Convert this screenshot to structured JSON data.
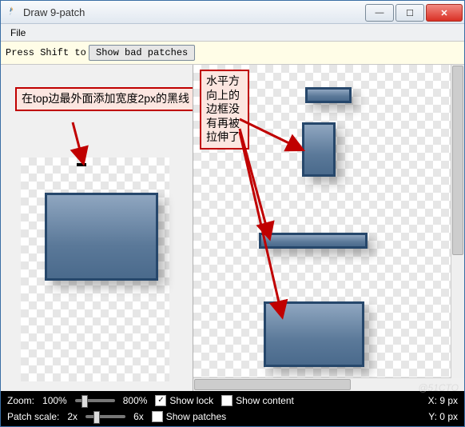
{
  "window": {
    "title": "Draw 9-patch"
  },
  "menu": {
    "file": "File"
  },
  "toolbar": {
    "hint_text": "Press Shift to er",
    "show_bad_patches_label": "Show bad patches"
  },
  "annotations": {
    "left_note": "在top边最外面添加宽度2px的黑线",
    "right_note": "水平方向上的边框没有再被拉伸了"
  },
  "statusbar": {
    "zoom_label": "Zoom:",
    "zoom_min": "100%",
    "zoom_max": "800%",
    "show_lock_label": "Show lock",
    "show_lock_checked": true,
    "show_content_label": "Show content",
    "show_content_checked": false,
    "x_label": "X: 9 px",
    "patch_scale_label": "Patch scale:",
    "patch_scale_min": "2x",
    "patch_scale_max": "6x",
    "show_patches_label": "Show patches",
    "show_patches_checked": false,
    "y_label": "Y: 0 px"
  },
  "watermark": "@51CTO"
}
